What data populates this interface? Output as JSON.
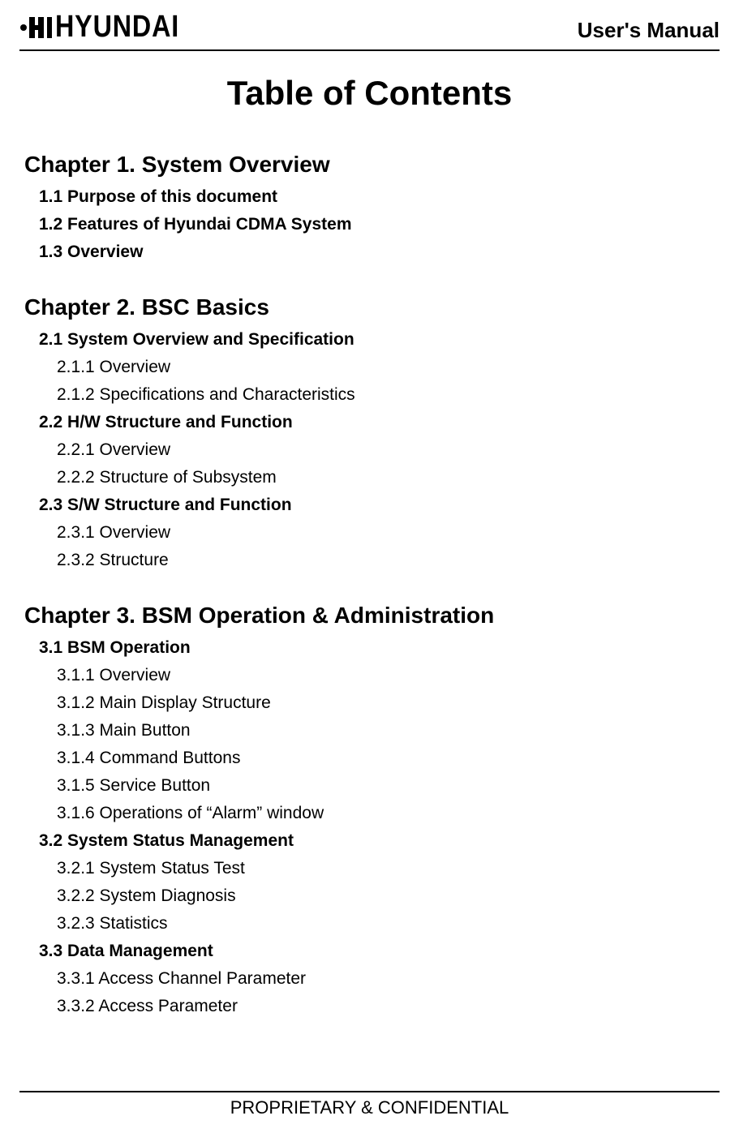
{
  "header": {
    "brand": "HYUNDAI",
    "doc_label": "User's Manual"
  },
  "title": "Table of Contents",
  "chapters": [
    {
      "title": "Chapter 1.  System Overview",
      "sections": [
        {
          "label": "1.1  Purpose of this document",
          "subs": []
        },
        {
          "label": "1.2  Features of Hyundai CDMA System",
          "subs": []
        },
        {
          "label": "1.3  Overview",
          "subs": []
        }
      ]
    },
    {
      "title": "Chapter 2.  BSC Basics",
      "sections": [
        {
          "label": "2.1  System Overview and Specification",
          "subs": [
            "2.1.1  Overview",
            "2.1.2  Specifications and Characteristics"
          ]
        },
        {
          "label": "2.2  H/W Structure and Function",
          "subs": [
            "2.2.1  Overview",
            "2.2.2  Structure of Subsystem"
          ]
        },
        {
          "label": "2.3  S/W Structure and Function",
          "subs": [
            "2.3.1  Overview",
            "2.3.2  Structure"
          ]
        }
      ]
    },
    {
      "title": "Chapter 3.  BSM Operation & Administration",
      "sections": [
        {
          "label": "3.1  BSM Operation",
          "subs": [
            "3.1.1  Overview",
            "3.1.2  Main Display Structure",
            "3.1.3  Main Button",
            "3.1.4  Command Buttons",
            "3.1.5  Service Button",
            "3.1.6  Operations of “Alarm” window"
          ]
        },
        {
          "label": "3.2  System Status Management",
          "subs": [
            "3.2.1  System Status Test",
            "3.2.2  System Diagnosis",
            "3.2.3  Statistics"
          ]
        },
        {
          "label": "3.3  Data Management",
          "subs": [
            "3.3.1  Access Channel Parameter",
            "3.3.2  Access Parameter"
          ]
        }
      ]
    }
  ],
  "footer": "PROPRIETARY & CONFIDENTIAL"
}
